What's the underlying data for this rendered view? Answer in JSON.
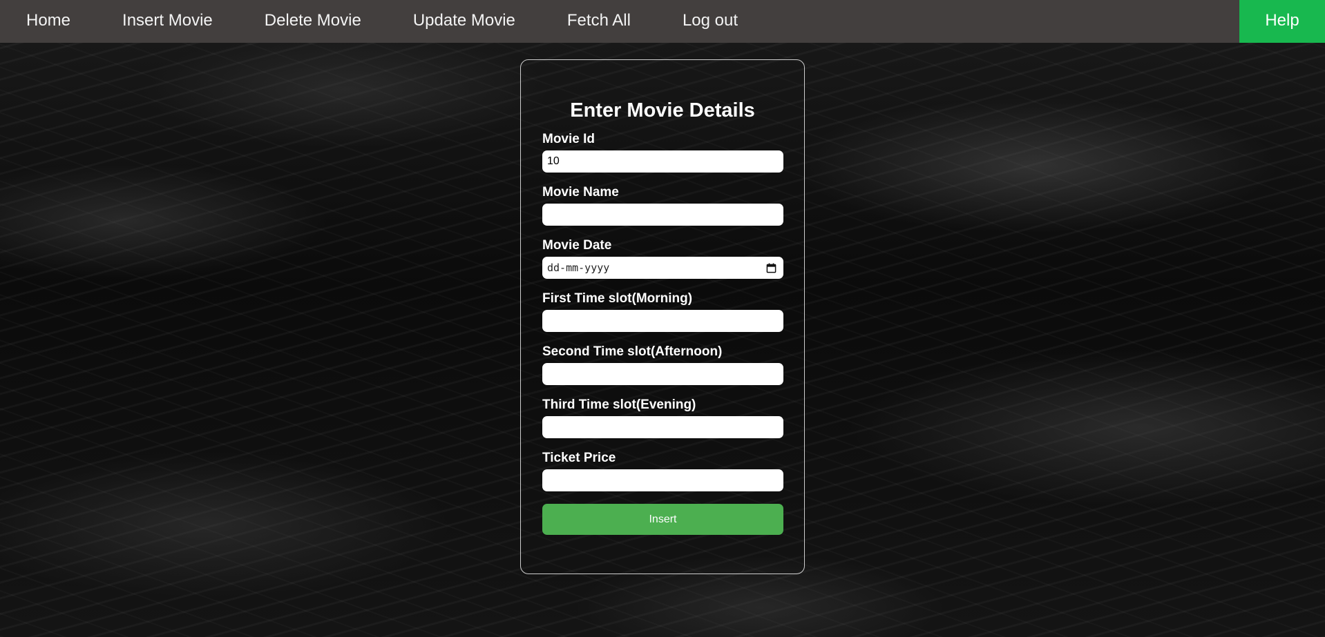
{
  "nav": {
    "items": [
      {
        "label": "Home"
      },
      {
        "label": "Insert Movie"
      },
      {
        "label": "Delete Movie"
      },
      {
        "label": "Update Movie"
      },
      {
        "label": "Fetch All"
      },
      {
        "label": "Log out"
      }
    ],
    "help_label": "Help",
    "help_color": "#18b84f",
    "bar_color": "#433f3e"
  },
  "form": {
    "title": "Enter Movie Details",
    "fields": {
      "movie_id": {
        "label": "Movie Id",
        "value": "10"
      },
      "movie_name": {
        "label": "Movie Name",
        "value": ""
      },
      "movie_date": {
        "label": "Movie Date",
        "placeholder": "dd-mm-yyyy",
        "icon": "calendar-icon"
      },
      "first_slot": {
        "label": "First Time slot(Morning)",
        "value": ""
      },
      "second_slot": {
        "label": "Second Time slot(Afternoon)",
        "value": ""
      },
      "third_slot": {
        "label": "Third Time slot(Evening)",
        "value": ""
      },
      "ticket_price": {
        "label": "Ticket Price",
        "value": ""
      }
    },
    "submit_label": "Insert",
    "submit_color": "#4caf50"
  }
}
